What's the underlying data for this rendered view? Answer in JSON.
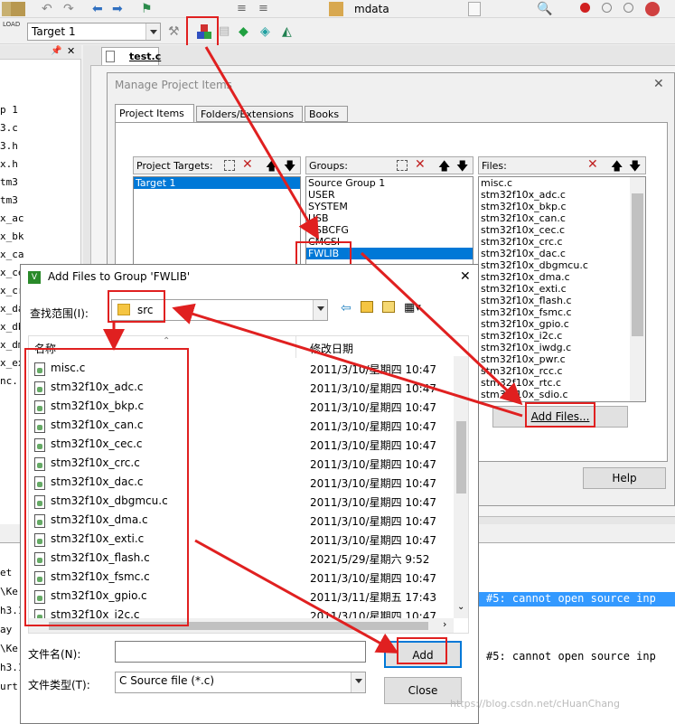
{
  "toolbar": {
    "target_select": "Target 1",
    "file_select": "mdata",
    "load_label": "LOAD"
  },
  "editor": {
    "tab": "test.c",
    "left_snips": [
      "p 1",
      "3.c",
      "3.h",
      "x.h",
      "tm3",
      "tm3",
      "x_ac",
      "x_bk",
      "x_ca",
      "x_ce",
      "x_cr",
      "x_da",
      "x_db",
      "x_dm",
      "x_ex",
      "nc..."
    ],
    "build_lines": [
      "et",
      "\\Ke",
      "h3.1",
      "ay",
      "\\Ke",
      "h3.1",
      "urt"
    ],
    "msg1": "#5: cannot open source inp",
    "msg2": "#5: cannot open source inp"
  },
  "manage": {
    "title": "Manage Project Items",
    "tabs": [
      "Project Items",
      "Folders/Extensions",
      "Books"
    ],
    "targets_label": "Project Targets:",
    "targets": [
      "Target 1"
    ],
    "groups_label": "Groups:",
    "groups": [
      "Source Group 1",
      "USER",
      "SYSTEM",
      "USB",
      "USBCFG",
      "CMCSI",
      "FWLIB"
    ],
    "files_label": "Files:",
    "files": [
      "misc.c",
      "stm32f10x_adc.c",
      "stm32f10x_bkp.c",
      "stm32f10x_can.c",
      "stm32f10x_cec.c",
      "stm32f10x_crc.c",
      "stm32f10x_dac.c",
      "stm32f10x_dbgmcu.c",
      "stm32f10x_dma.c",
      "stm32f10x_exti.c",
      "stm32f10x_flash.c",
      "stm32f10x_fsmc.c",
      "stm32f10x_gpio.c",
      "stm32f10x_i2c.c",
      "stm32f10x_iwdg.c",
      "stm32f10x_pwr.c",
      "stm32f10x_rcc.c",
      "stm32f10x_rtc.c",
      "stm32f10x_sdio.c"
    ],
    "add_files_button": "Add Files...",
    "help_button": "Help"
  },
  "addfiles": {
    "title": "Add Files to Group 'FWLIB'",
    "lookin_label": "查找范围(I):",
    "lookin_value": "src",
    "col_name": "名称",
    "col_date": "修改日期",
    "rows": [
      {
        "name": "misc.c",
        "date": "2011/3/10/星期四 10:47"
      },
      {
        "name": "stm32f10x_adc.c",
        "date": "2011/3/10/星期四 10:47"
      },
      {
        "name": "stm32f10x_bkp.c",
        "date": "2011/3/10/星期四 10:47"
      },
      {
        "name": "stm32f10x_can.c",
        "date": "2011/3/10/星期四 10:47"
      },
      {
        "name": "stm32f10x_cec.c",
        "date": "2011/3/10/星期四 10:47"
      },
      {
        "name": "stm32f10x_crc.c",
        "date": "2011/3/10/星期四 10:47"
      },
      {
        "name": "stm32f10x_dac.c",
        "date": "2011/3/10/星期四 10:47"
      },
      {
        "name": "stm32f10x_dbgmcu.c",
        "date": "2011/3/10/星期四 10:47"
      },
      {
        "name": "stm32f10x_dma.c",
        "date": "2011/3/10/星期四 10:47"
      },
      {
        "name": "stm32f10x_exti.c",
        "date": "2011/3/10/星期四 10:47"
      },
      {
        "name": "stm32f10x_flash.c",
        "date": "2021/5/29/星期六 9:52"
      },
      {
        "name": "stm32f10x_fsmc.c",
        "date": "2011/3/10/星期四 10:47"
      },
      {
        "name": "stm32f10x_gpio.c",
        "date": "2011/3/11/星期五 17:43"
      },
      {
        "name": "stm32f10x_i2c.c",
        "date": "2011/3/10/星期四 10:47"
      }
    ],
    "filename_label": "文件名(N):",
    "filename_value": "",
    "filetype_label": "文件类型(T):",
    "filetype_value": "C Source file (*.c)",
    "add_button": "Add",
    "close_button": "Close"
  },
  "watermark": "https://blog.csdn.net/cHuanChang"
}
